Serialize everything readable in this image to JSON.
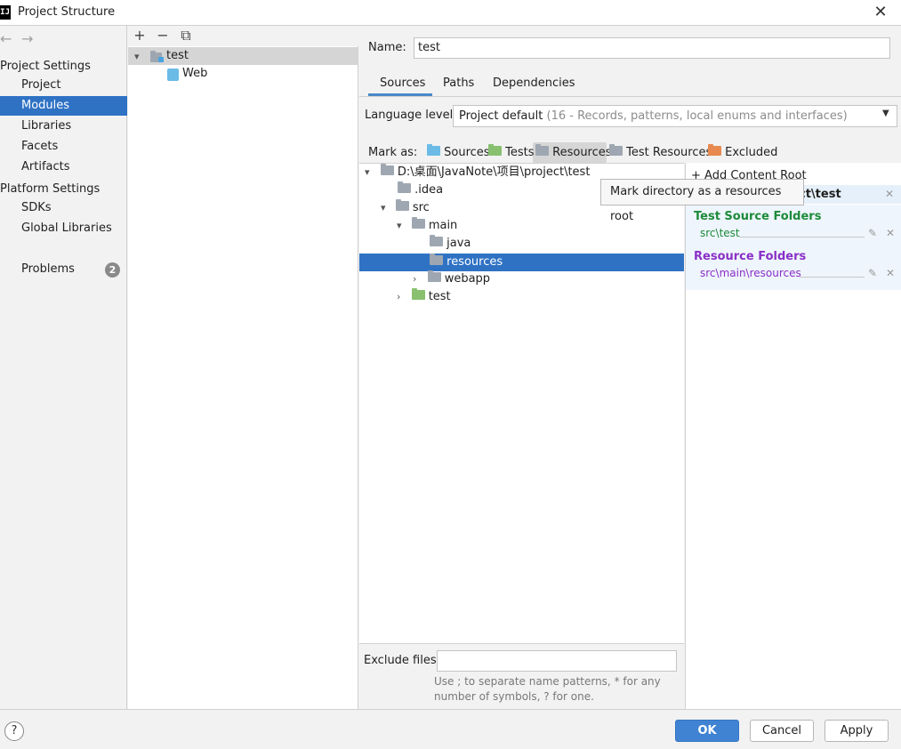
{
  "window": {
    "title": "Project Structure",
    "app_icon": "IJ"
  },
  "nav": {
    "back_icon": "←",
    "forward_icon": "→"
  },
  "sidebar": {
    "section1": "Project Settings",
    "items1": [
      "Project",
      "Modules",
      "Libraries",
      "Facets",
      "Artifacts"
    ],
    "section2": "Platform Settings",
    "items2": [
      "SDKs",
      "Global Libraries"
    ],
    "problems_label": "Problems",
    "problems_count": "2",
    "selected": "Modules"
  },
  "module_tree": {
    "toolbar": {
      "add": "+",
      "remove": "−",
      "copy": "⧉"
    },
    "root": "test",
    "child": "Web"
  },
  "name_field": {
    "label": "Name:",
    "value": "test"
  },
  "tabs": [
    "Sources",
    "Paths",
    "Dependencies"
  ],
  "language": {
    "label": "Language level:",
    "value": "Project default",
    "detail": "(16 - Records, patterns, local enums and interfaces)"
  },
  "mark_as": {
    "label": "Mark as:",
    "items": [
      "Sources",
      "Tests",
      "Resources",
      "Test Resources",
      "Excluded"
    ]
  },
  "tooltip": "Mark directory as a resources root",
  "dir_tree": {
    "root": "D:\\桌面\\JavaNote\\项目\\project\\test",
    "idea": ".idea",
    "src": "src",
    "main": "main",
    "java": "java",
    "resources": "resources",
    "webapp": "webapp",
    "test": "test"
  },
  "content_roots": {
    "add_label": "Add Content Root",
    "root_path": "ct\\test",
    "test_source_title": "Test Source Folders",
    "test_source_path": "src\\test",
    "resource_title": "Resource Folders",
    "resource_path": "src\\main\\resources"
  },
  "exclude": {
    "label": "Exclude files:",
    "value": "",
    "hint_line1": "Use ; to separate name patterns, * for any",
    "hint_line2": "number of symbols, ? for one."
  },
  "buttons": {
    "ok": "OK",
    "cancel": "Cancel",
    "apply": "Apply",
    "help": "?"
  },
  "colors": {
    "selection": "#2f72c4",
    "test_green": "#1d8a3a",
    "resource_purple": "#8a2fc7",
    "ok_blue": "#3f83d2"
  }
}
